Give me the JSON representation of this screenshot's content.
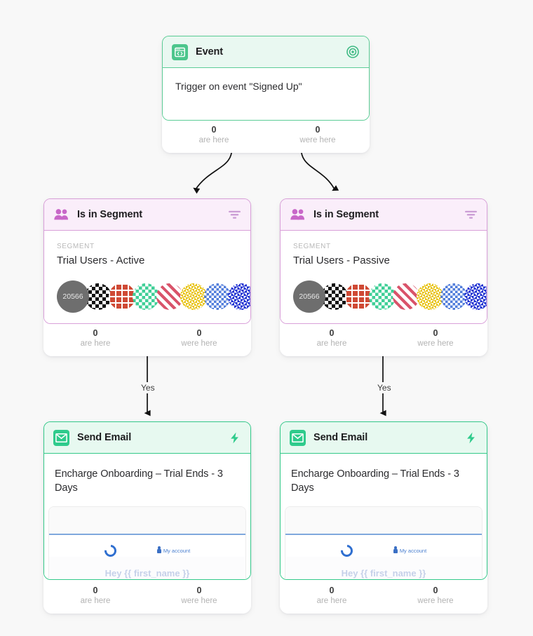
{
  "canvas": {
    "background": "#f8f8f8"
  },
  "stat_labels": {
    "are_here": "are here",
    "were_here": "were here"
  },
  "nodes": {
    "event": {
      "title": "Event",
      "icon": "code-browser-icon",
      "action_icon": "target-icon",
      "body_text": "Trigger on event \"Signed Up\"",
      "accent": "#4cc68c",
      "stats": {
        "are_here": "0",
        "were_here": "0"
      }
    },
    "segment_left": {
      "title": "Is in Segment",
      "icon": "users-icon",
      "action_icon": "filter-icon",
      "field_label": "SEGMENT",
      "segment_name": "Trial Users - Active",
      "avatar_count": "20566",
      "accent": "#d9a0d9",
      "stats": {
        "are_here": "0",
        "were_here": "0"
      }
    },
    "segment_right": {
      "title": "Is in Segment",
      "icon": "users-icon",
      "action_icon": "filter-icon",
      "field_label": "SEGMENT",
      "segment_name": "Trial Users - Passive",
      "avatar_count": "20566",
      "accent": "#d9a0d9",
      "stats": {
        "are_here": "0",
        "were_here": "0"
      }
    },
    "email_left": {
      "title": "Send Email",
      "icon": "envelope-icon",
      "action_icon": "lightning-bolt-icon",
      "subject": "Encharge Onboarding – Trial Ends - 3 Days",
      "preview_account_label": "My account",
      "preview_cut_text": "Hey {{ first_name }}",
      "accent": "#34c98a",
      "stats": {
        "are_here": "0",
        "were_here": "0"
      }
    },
    "email_right": {
      "title": "Send Email",
      "icon": "envelope-icon",
      "action_icon": "lightning-bolt-icon",
      "subject": "Encharge Onboarding – Trial Ends - 3 Days",
      "preview_account_label": "My account",
      "preview_cut_text": "Hey {{ first_name }}",
      "accent": "#34c98a",
      "stats": {
        "are_here": "0",
        "were_here": "0"
      }
    }
  },
  "connectors": {
    "branch_left_label": "",
    "branch_right_label": "",
    "yes_left": "Yes",
    "yes_right": "Yes"
  },
  "avatar_colors": [
    "#6e6e6e",
    "#1b1b1b",
    "#cf4a35",
    "#3fcf97",
    "#d9536a",
    "#e8c315",
    "#3f6fd8",
    "#1c2fd1",
    "#f261b6",
    "#efeec0",
    "#dedede"
  ]
}
